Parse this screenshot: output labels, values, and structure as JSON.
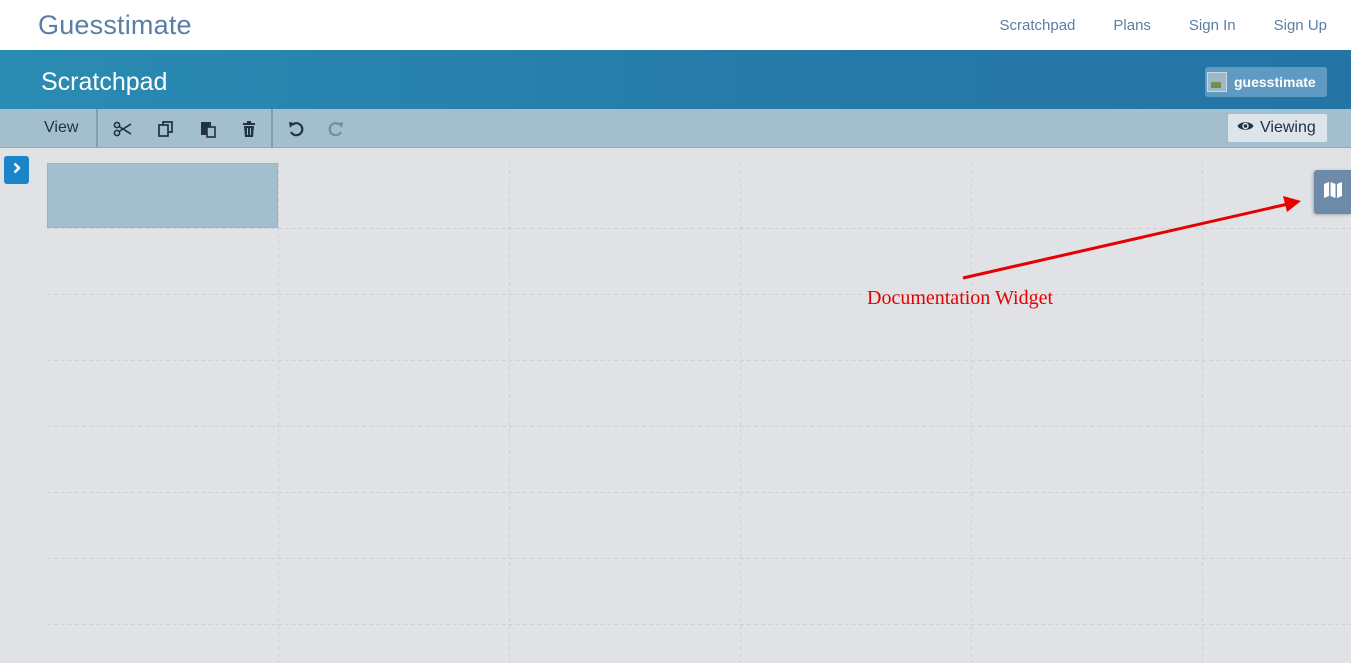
{
  "app": {
    "brand": "Guesstimate"
  },
  "nav": {
    "links": [
      "Scratchpad",
      "Plans",
      "Sign In",
      "Sign Up"
    ]
  },
  "header": {
    "title": "Scratchpad",
    "owner": "guesstimate"
  },
  "toolbar": {
    "view_label": "View",
    "viewing_label": "Viewing",
    "icons": [
      "scissors-icon",
      "copy-icon",
      "paste-icon",
      "trash-icon",
      "undo-icon",
      "redo-icon",
      "eye-icon"
    ]
  },
  "sidebar": {
    "toggle_icon": "chevron-right-icon"
  },
  "doc_widget": {
    "icon": "map-icon"
  },
  "annotation": {
    "label": "Documentation Widget",
    "color": "#e60000"
  },
  "colors": {
    "brand": "#5a7ea6",
    "header": "#2679a8",
    "toolbar": "#a3bfce",
    "canvas": "#e0e2e5",
    "accent": "#1a85c9"
  }
}
